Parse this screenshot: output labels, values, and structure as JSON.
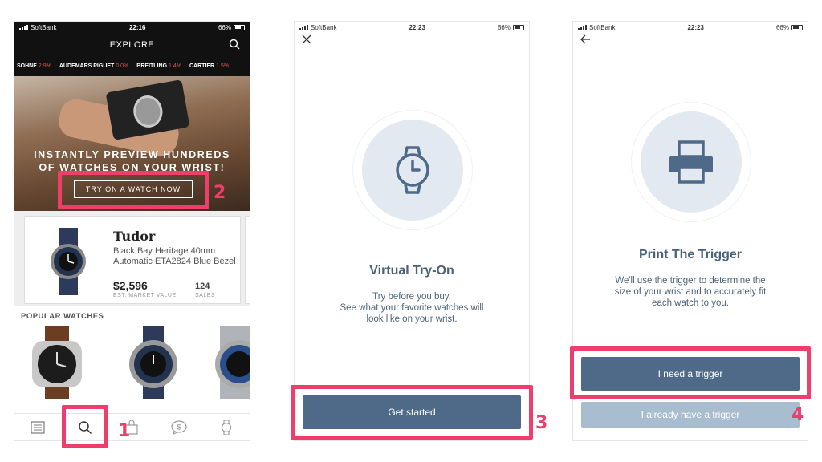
{
  "status_bars": {
    "p1": {
      "carrier": "SoftBank",
      "time": "22:16",
      "battery": "66%"
    },
    "p2": {
      "carrier": "SoftBank",
      "time": "22:23",
      "battery": "66%"
    },
    "p3": {
      "carrier": "SoftBank",
      "time": "22:23",
      "battery": "66%"
    }
  },
  "explore": {
    "title": "EXPLORE",
    "ticker": [
      {
        "name": "SOHNE",
        "pct": "2.9%"
      },
      {
        "name": "AUDEMARS PIGUET",
        "pct": "0.0%"
      },
      {
        "name": "BREITLING",
        "pct": "1.4%"
      },
      {
        "name": "CARTIER",
        "pct": "1.5%"
      }
    ],
    "hero": {
      "line1": "INSTANTLY PREVIEW HUNDREDS",
      "line2": "OF WATCHES ON YOUR WRIST!",
      "button": "TRY ON A WATCH NOW"
    },
    "card": {
      "brand": "Tudor",
      "desc_line1": "Black Bay Heritage 40mm",
      "desc_line2": "Automatic ETA2824 Blue Bezel",
      "price": "$2,596",
      "price_label": "EST. MARKET VALUE",
      "sales": "124",
      "sales_label": "SALES"
    },
    "popular_title": "POPULAR WATCHES",
    "tabs": [
      "news-icon",
      "search-icon",
      "bag-icon",
      "dollar-icon",
      "watch-icon"
    ]
  },
  "tryon": {
    "title": "Virtual Try-On",
    "body_line1": "Try before you buy.",
    "body_line2": "See what your favorite watches will",
    "body_line3": "look like on your wrist.",
    "button": "Get started"
  },
  "print": {
    "title": "Print The Trigger",
    "body_line1": "We'll use the trigger to determine the",
    "body_line2": "size of your wrist and to accurately fit",
    "body_line3": "each watch to you.",
    "primary_button": "I need a trigger",
    "secondary_button": "I already have a trigger"
  },
  "annotations": [
    "1",
    "2",
    "3",
    "4"
  ],
  "colors": {
    "highlight": "#ee3e6b",
    "button_primary": "#4e6a88",
    "button_secondary": "#a9bdd0",
    "text_heading": "#4a6278"
  }
}
